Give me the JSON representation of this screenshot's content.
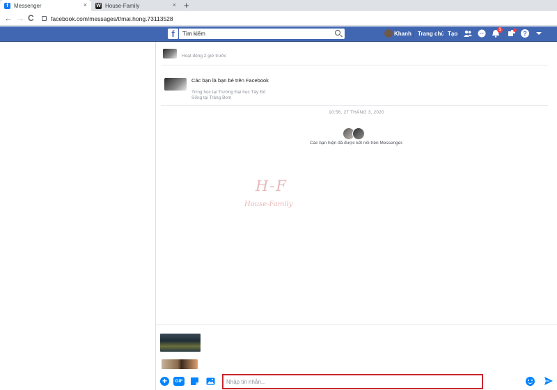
{
  "browser": {
    "tabs": [
      {
        "title": "Messenger",
        "favicon": "f",
        "favicon_color": "#1877f2",
        "close": "×"
      },
      {
        "title": "House-Family",
        "favicon": "W",
        "favicon_color": "#222222",
        "close": "×"
      }
    ],
    "new_tab": "+",
    "back": "←",
    "forward": "→",
    "reload": "C",
    "url": "facebook.com/messages/t/mai.hong.73113528"
  },
  "fb": {
    "logo": "f",
    "search_placeholder": "Tìm kiếm",
    "user_name": "Khanh",
    "nav": [
      "Trang chủ",
      "Tạo"
    ],
    "notification_count": "1",
    "brand_color": "#4267b2"
  },
  "conversation": {
    "active_status": "Hoạt động 2 giờ trước",
    "friends_title": "Các bạn là bạn bè trên Facebook",
    "friends_details": [
      "Từng học tại Trường Đại học Tây Đô",
      "Sống tại Trảng Bom"
    ],
    "timestamp": "10:56, 27 THÁNG 3, 2020",
    "connected_text": "Các bạn hiện đã được kết nối trên Messenger."
  },
  "watermark": {
    "line1": "H-F",
    "line2": "House-Family"
  },
  "composer": {
    "placeholder": "Nhập tin nhắn...",
    "gif_label": "GIF",
    "accent_color": "#0084ff",
    "highlight_color": "#c9262c"
  }
}
